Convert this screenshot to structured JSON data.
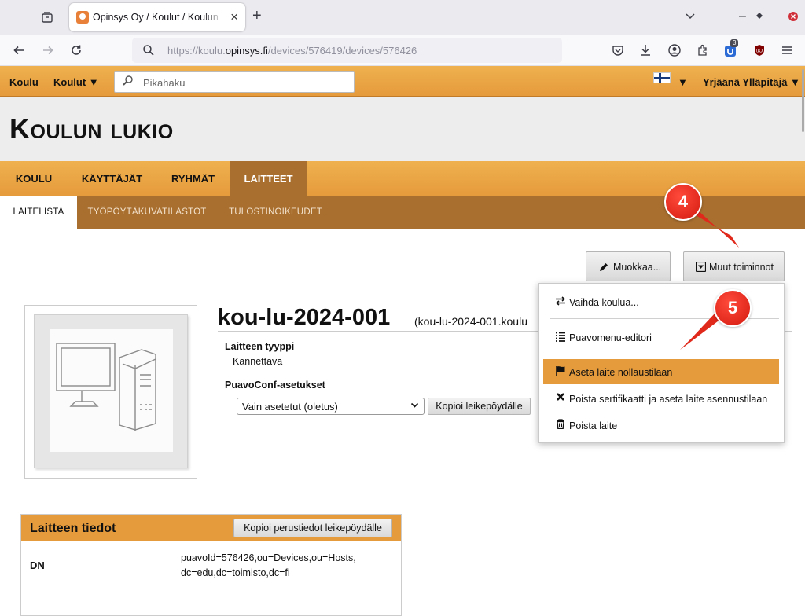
{
  "browser": {
    "tab_title": "Opinsys Oy / Koulut / Koulun lukio",
    "url_prefix": "https://koulu.",
    "url_domain": "opinsys.fi",
    "url_path": "/devices/576419/devices/576426",
    "extension_badge": "3"
  },
  "header": {
    "koulu": "Koulu",
    "koulut": "Koulut ▼",
    "search_placeholder": "Pikahaku",
    "language_arrow": "▼",
    "user": "Yrjäänä Ylläpitäjä ▼"
  },
  "page_title": "Koulun lukio",
  "main_tabs": [
    "KOULU",
    "KÄYTTÄJÄT",
    "RYHMÄT",
    "LAITTEET"
  ],
  "sub_tabs": [
    "LAITELISTA",
    "TYÖPÖYTÄKUVATILASTOT",
    "TULOSTINOIKEUDET"
  ],
  "actions": {
    "edit": "Muokkaa...",
    "other": "Muut toiminnot"
  },
  "device": {
    "name": "kou-lu-2024-001",
    "fqdn": "(kou-lu-2024-001.koulu",
    "type_label": "Laitteen tyyppi",
    "type_value": "Kannettava",
    "puavoconf_label": "PuavoConf-asetukset",
    "puavoconf_select": "Vain asetetut (oletus)",
    "copy_clipboard": "Kopioi leikepöydälle"
  },
  "info_panel": {
    "title": "Laitteen tiedot",
    "copy_button": "Kopioi perustiedot leikepöydälle",
    "dn_label": "DN",
    "dn_line1": "puavoId=576426,ou=Devices,ou=Hosts,",
    "dn_line2": "dc=edu,dc=toimisto,dc=fi"
  },
  "menu": {
    "items": [
      {
        "label": "Vaihda koulua...",
        "icon": "swap-icon"
      },
      {
        "label": "Puavomenu-editori",
        "icon": "list-icon"
      },
      {
        "label": "Aseta laite nollaustilaan",
        "icon": "flag-icon"
      },
      {
        "label": "Poista sertifikaatti ja aseta laite asennustilaan",
        "icon": "x-icon"
      },
      {
        "label": "Poista laite",
        "icon": "trash-icon"
      }
    ]
  },
  "callouts": [
    "4",
    "5"
  ],
  "colors": {
    "accent": "#e59a3b",
    "subnav": "#a96f2f",
    "callout": "#e0281b"
  }
}
